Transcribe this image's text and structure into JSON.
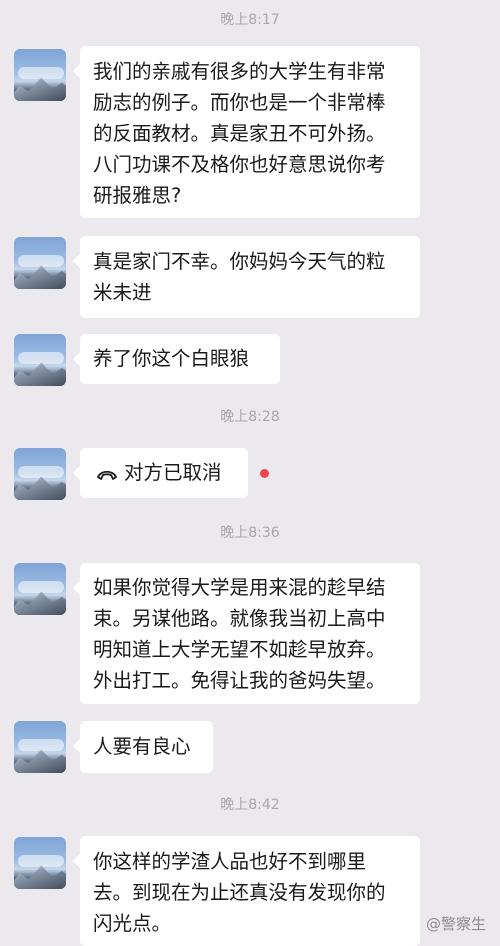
{
  "chat": {
    "timestamps": [
      "晚上8:17",
      "晚上8:28",
      "晚上8:36",
      "晚上8:42"
    ],
    "messages": [
      {
        "lines": [
          "我们的亲戚有很多的大学生有非常",
          "励志的例子。而你也是一个非常棒",
          "的反面教材。真是家丑不可外扬。",
          "八门功课不及格你也好意思说你考",
          "研报雅思?"
        ]
      },
      {
        "lines": [
          "真是家门不幸。你妈妈今天气的粒",
          "米未进"
        ]
      },
      {
        "lines": [
          "养了你这个白眼狼"
        ]
      },
      {
        "lines": [
          "对方已取消"
        ],
        "icon": "phone-hangup-icon",
        "unread_dot_color": "#f2454a"
      },
      {
        "lines": [
          "如果你觉得大学是用来混的趁早结",
          "束。另谋他路。就像我当初上高中",
          "明知道上大学无望不如趁早放弃。",
          "外出打工。免得让我的爸妈失望。"
        ]
      },
      {
        "lines": [
          "人要有良心"
        ]
      },
      {
        "lines": [
          "你这样的学渣人品也好不到哪里",
          "去。到现在为止还真没有发现你的",
          "闪光点。"
        ]
      }
    ]
  },
  "watermark": {
    "text": "@警察生"
  },
  "colors": {
    "background": "#ece9ee",
    "bubble": "#ffffff",
    "timestamp": "#a9a6ab"
  }
}
